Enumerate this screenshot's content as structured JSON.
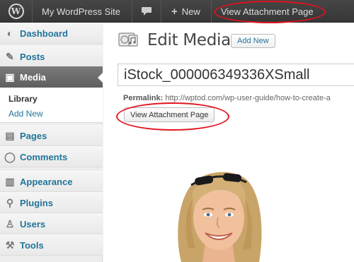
{
  "admin_bar": {
    "site_name": "My WordPress Site",
    "new_label": "New",
    "new_prefix": "+",
    "view_label": "View Attachment Page",
    "logo_glyph": "W"
  },
  "sidebar": {
    "items": [
      {
        "label": "Dashboard",
        "icon": "dashboard-icon",
        "glyph": "◐"
      },
      {
        "label": "Posts",
        "icon": "pin-icon",
        "glyph": "✎"
      },
      {
        "label": "Media",
        "icon": "media-icon",
        "glyph": "▣"
      },
      {
        "label": "Pages",
        "icon": "pages-icon",
        "glyph": "▤"
      },
      {
        "label": "Comments",
        "icon": "comments-icon",
        "glyph": "◯"
      },
      {
        "label": "Appearance",
        "icon": "appearance-icon",
        "glyph": "▥"
      },
      {
        "label": "Plugins",
        "icon": "plugins-icon",
        "glyph": "⚲"
      },
      {
        "label": "Users",
        "icon": "users-icon",
        "glyph": "♙"
      },
      {
        "label": "Tools",
        "icon": "tools-icon",
        "glyph": "⚒"
      }
    ],
    "submenu": {
      "library": "Library",
      "add_new": "Add New"
    },
    "active_color": "#6d6d6d",
    "link_color": "#21759b"
  },
  "main": {
    "page_title": "Edit Media",
    "add_new_button": "Add New",
    "title_value": "iStock_000006349336XSmall",
    "permalink_label": "Permalink:",
    "permalink_url": "http://wptod.com/wp-user-guide/how-to-create-a",
    "view_button": "View Attachment Page"
  },
  "annotation_color": "#e0131e"
}
